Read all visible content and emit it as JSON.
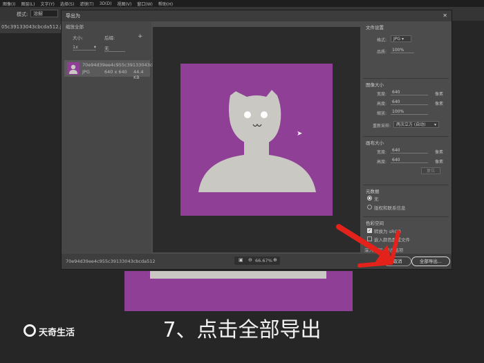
{
  "menu": [
    "图像(I)",
    "图层(L)",
    "文字(Y)",
    "选择(S)",
    "滤镜(T)",
    "3D(D)",
    "视图(V)",
    "窗口(W)",
    "帮助(H)"
  ],
  "options_bar": {
    "mode_label": "模式:",
    "mode_value": "溶解"
  },
  "doc_tab": "05c39133043cbcda512.jpeg @ 10",
  "dialog": {
    "title": "导出为",
    "left_panel": {
      "scale_all": "缩放全部",
      "size_label": "大小:",
      "suffix_label": "后缀:",
      "add_symbol": "+",
      "size_value": "1x",
      "suffix_value": "无",
      "asset": {
        "name": "70e94d39ee4c955c39133043cbc...",
        "format": "JPG",
        "dims": "640 x 640",
        "filesize": "44.4 KB"
      }
    },
    "file_settings": {
      "title": "文件设置",
      "format_label": "格式:",
      "format_value": "JPG",
      "quality_label": "品质:",
      "quality_value": "100%"
    },
    "image_size": {
      "title": "图像大小",
      "width_label": "宽度:",
      "width_value": "640",
      "width_unit": "像素",
      "height_label": "高度:",
      "height_value": "640",
      "height_unit": "像素",
      "scale_label": "缩放:",
      "scale_value": "100%",
      "resample_label": "重新采样:",
      "resample_value": "两次立方 (自动)"
    },
    "canvas_size": {
      "title": "画布大小",
      "width_label": "宽度:",
      "width_value": "640",
      "width_unit": "像素",
      "height_label": "高度:",
      "height_value": "640",
      "height_unit": "像素",
      "reset_label": "复位"
    },
    "metadata": {
      "title": "元数据",
      "opt_none": "无",
      "opt_copyright": "版权和联系信息"
    },
    "color_space": {
      "title": "色彩空间",
      "convert_srgb": "转换为 sRGB",
      "embed_profile": "嵌入颜色配置文件"
    },
    "learn_more": "深入了解: 导出选项",
    "bottom": {
      "filename": "70e94d39ee4c955c39133043cbcda512",
      "zoom": "66.67%"
    },
    "cancel_label": "取消",
    "export_all_label": "全部导出..."
  },
  "caption": "7、点击全部导出",
  "watermark": "天奇生活",
  "colors": {
    "canvas_purple": "#8f3f96",
    "figure_gray": "#c9c8c2",
    "arrow_red": "#e3231b"
  }
}
